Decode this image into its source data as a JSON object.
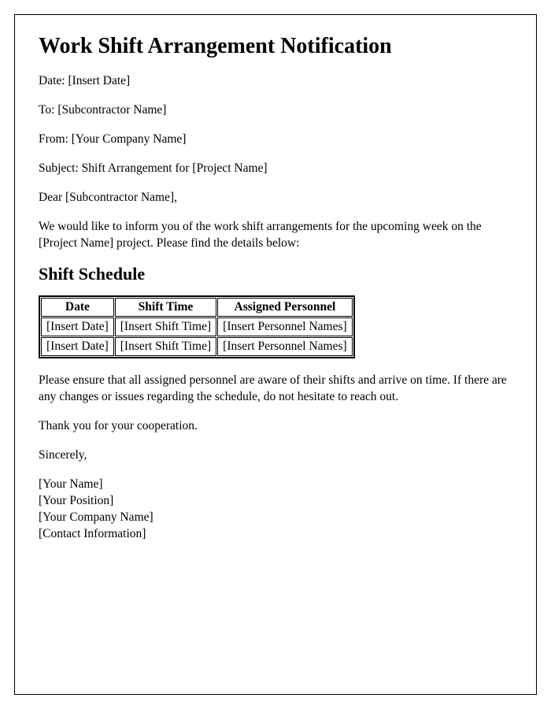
{
  "title": "Work Shift Arrangement Notification",
  "header": {
    "date": "Date: [Insert Date]",
    "to": "To: [Subcontractor Name]",
    "from": "From: [Your Company Name]",
    "subject": "Subject: Shift Arrangement for [Project Name]"
  },
  "salutation": "Dear [Subcontractor Name],",
  "intro": "We would like to inform you of the work shift arrangements for the upcoming week on the [Project Name] project. Please find the details below:",
  "scheduleHeading": "Shift Schedule",
  "table": {
    "headers": {
      "date": "Date",
      "shiftTime": "Shift Time",
      "personnel": "Assigned Personnel"
    },
    "rows": [
      {
        "date": "[Insert Date]",
        "shiftTime": "[Insert Shift Time]",
        "personnel": "[Insert Personnel Names]"
      },
      {
        "date": "[Insert Date]",
        "shiftTime": "[Insert Shift Time]",
        "personnel": "[Insert Personnel Names]"
      }
    ]
  },
  "notice": "Please ensure that all assigned personnel are aware of their shifts and arrive on time. If there are any changes or issues regarding the schedule, do not hesitate to reach out.",
  "thanks": "Thank you for your cooperation.",
  "closing": "Sincerely,",
  "signature": {
    "name": "[Your Name]",
    "position": "[Your Position]",
    "company": "[Your Company Name]",
    "contact": "[Contact Information]"
  }
}
